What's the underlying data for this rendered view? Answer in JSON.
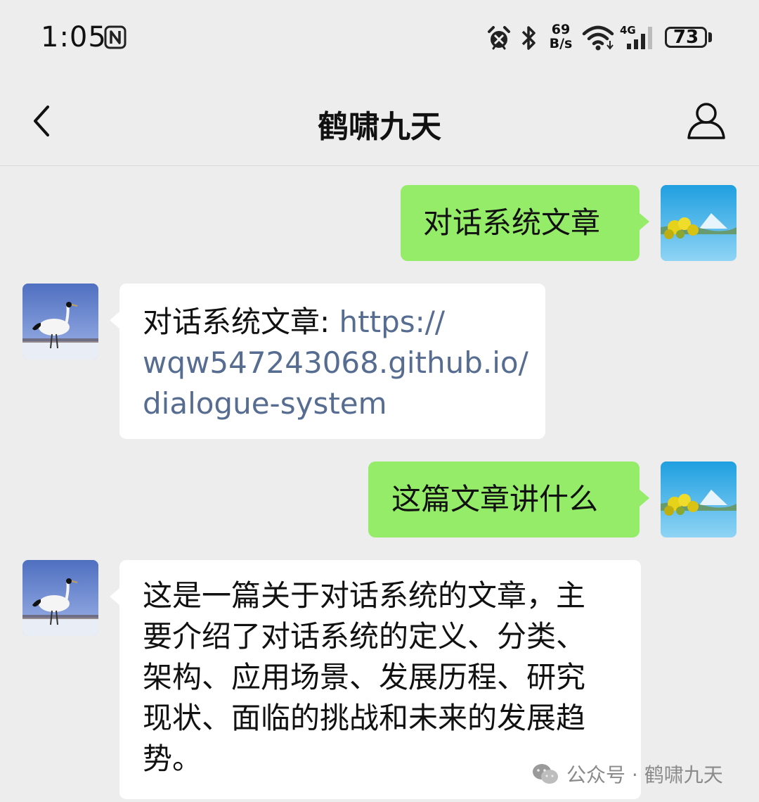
{
  "status_bar": {
    "time": "1:05",
    "net_speed_value": "69",
    "net_speed_unit": "B/s",
    "network_type": "4G",
    "battery": "73",
    "icons": [
      "nfc-icon",
      "alarm-icon",
      "bluetooth-icon",
      "wifi-icon",
      "signal-icon",
      "battery-icon"
    ]
  },
  "nav": {
    "title": "鹤啸九天",
    "back_icon": "chevron-left-icon",
    "profile_icon": "person-icon"
  },
  "messages": [
    {
      "direction": "outgoing",
      "text": "对话系统文章"
    },
    {
      "direction": "incoming",
      "text_prefix": "对话系统文章: ",
      "link_line1": "https://",
      "link_line2": "wqw547243068.github.io/",
      "link_line3": "dialogue-system"
    },
    {
      "direction": "outgoing",
      "text": "这篇文章讲什么"
    },
    {
      "direction": "incoming",
      "lines": [
        "这是一篇关于对话系统的文章，主",
        "要介绍了对话系统的定义、分类、",
        "架构、应用场景、发展历程、研究",
        "现状、面临的挑战和未来的发展趋",
        "势。"
      ]
    }
  ],
  "watermark": {
    "text": "公众号 · 鹤啸九天"
  },
  "colors": {
    "background": "#ededed",
    "outgoing_bubble": "#95ec69",
    "incoming_bubble": "#ffffff",
    "link": "#566c90"
  }
}
